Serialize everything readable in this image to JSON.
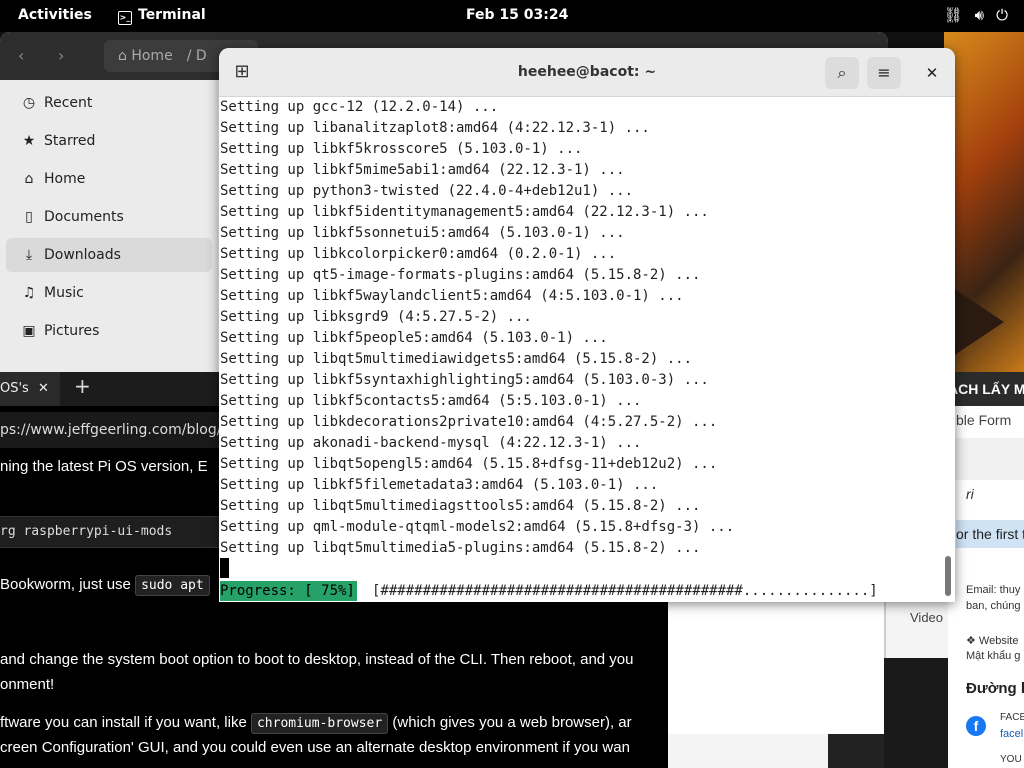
{
  "topbar": {
    "activities": "Activities",
    "app_name": "Terminal",
    "clock": "Feb 15  03:24"
  },
  "files": {
    "path": "Home",
    "path_next": "D",
    "sidebar": [
      {
        "label": "Recent",
        "icon": "clock-icon",
        "glyph": "◷"
      },
      {
        "label": "Starred",
        "icon": "star-icon",
        "glyph": "★"
      },
      {
        "label": "Home",
        "icon": "home-icon",
        "glyph": "⌂"
      },
      {
        "label": "Documents",
        "icon": "document-icon",
        "glyph": "▯"
      },
      {
        "label": "Downloads",
        "icon": "download-icon",
        "glyph": "⤓"
      },
      {
        "label": "Music",
        "icon": "music-icon",
        "glyph": "♫"
      },
      {
        "label": "Pictures",
        "icon": "picture-icon",
        "glyph": "▣"
      }
    ],
    "active_item": "Downloads"
  },
  "browser": {
    "tab_label": "OS's",
    "url": "ps://www.jeffgeerling.com/blog/",
    "lines": [
      "ning the latest Pi OS version, E",
      "rg raspberrypi-ui-mods",
      "Bookworm, just use",
      "sudo apt",
      "and change the system boot option to boot to desktop, instead of the CLI. Then reboot, and you",
      "onment!",
      "ftware you can install if you want, like",
      "chromium-browser",
      "(which gives you a web browser), ar",
      "creen Configuration' GUI, and you could even use an alternate desktop environment if you wan"
    ]
  },
  "office": {
    "title": "ÁCH LẤY M",
    "menu": "ble  Form",
    "italic_text": "ri",
    "blue_text": "or the first t",
    "email_line1": "Email: thuy",
    "email_line2": "ban, chúng",
    "website_line1": "❖ Website",
    "website_line2": "Mật khẩu g",
    "heading": "Đường l",
    "fb_line1": "FACE",
    "fb_line2": "facel",
    "yt_line": "YOU"
  },
  "video": {
    "label": "Video"
  },
  "terminal": {
    "title": "heehee@bacot: ~",
    "lines": [
      "Setting up gcc-12 (12.2.0-14) ...",
      "Setting up libanalitzaplot8:amd64 (4:22.12.3-1) ...",
      "Setting up libkf5krosscore5 (5.103.0-1) ...",
      "Setting up libkf5mime5abi1:amd64 (22.12.3-1) ...",
      "Setting up python3-twisted (22.4.0-4+deb12u1) ...",
      "Setting up libkf5identitymanagement5:amd64 (22.12.3-1) ...",
      "Setting up libkf5sonnetui5:amd64 (5.103.0-1) ...",
      "Setting up libkcolorpicker0:amd64 (0.2.0-1) ...",
      "Setting up qt5-image-formats-plugins:amd64 (5.15.8-2) ...",
      "Setting up libkf5waylandclient5:amd64 (4:5.103.0-1) ...",
      "Setting up libksgrd9 (4:5.27.5-2) ...",
      "Setting up libkf5people5:amd64 (5.103.0-1) ...",
      "Setting up libqt5multimediawidgets5:amd64 (5.15.8-2) ...",
      "Setting up libkf5syntaxhighlighting5:amd64 (5.103.0-3) ...",
      "Setting up libkf5contacts5:amd64 (5:5.103.0-1) ...",
      "Setting up libkdecorations2private10:amd64 (4:5.27.5-2) ...",
      "Setting up akonadi-backend-mysql (4:22.12.3-1) ...",
      "Setting up libqt5opengl5:amd64 (5.15.8+dfsg-11+deb12u2) ...",
      "Setting up libkf5filemetadata3:amd64 (5.103.0-1) ...",
      "Setting up libqt5multimediagsttools5:amd64 (5.15.8-2) ...",
      "Setting up qml-module-qtqml-models2:amd64 (5.15.8+dfsg-3) ...",
      "Setting up libqt5multimedia5-plugins:amd64 (5.15.8-2) ..."
    ],
    "progress_label": "Progress: [ 75%]",
    "progress_bar": "[###########################################...............]",
    "progress_value": 0.75
  }
}
